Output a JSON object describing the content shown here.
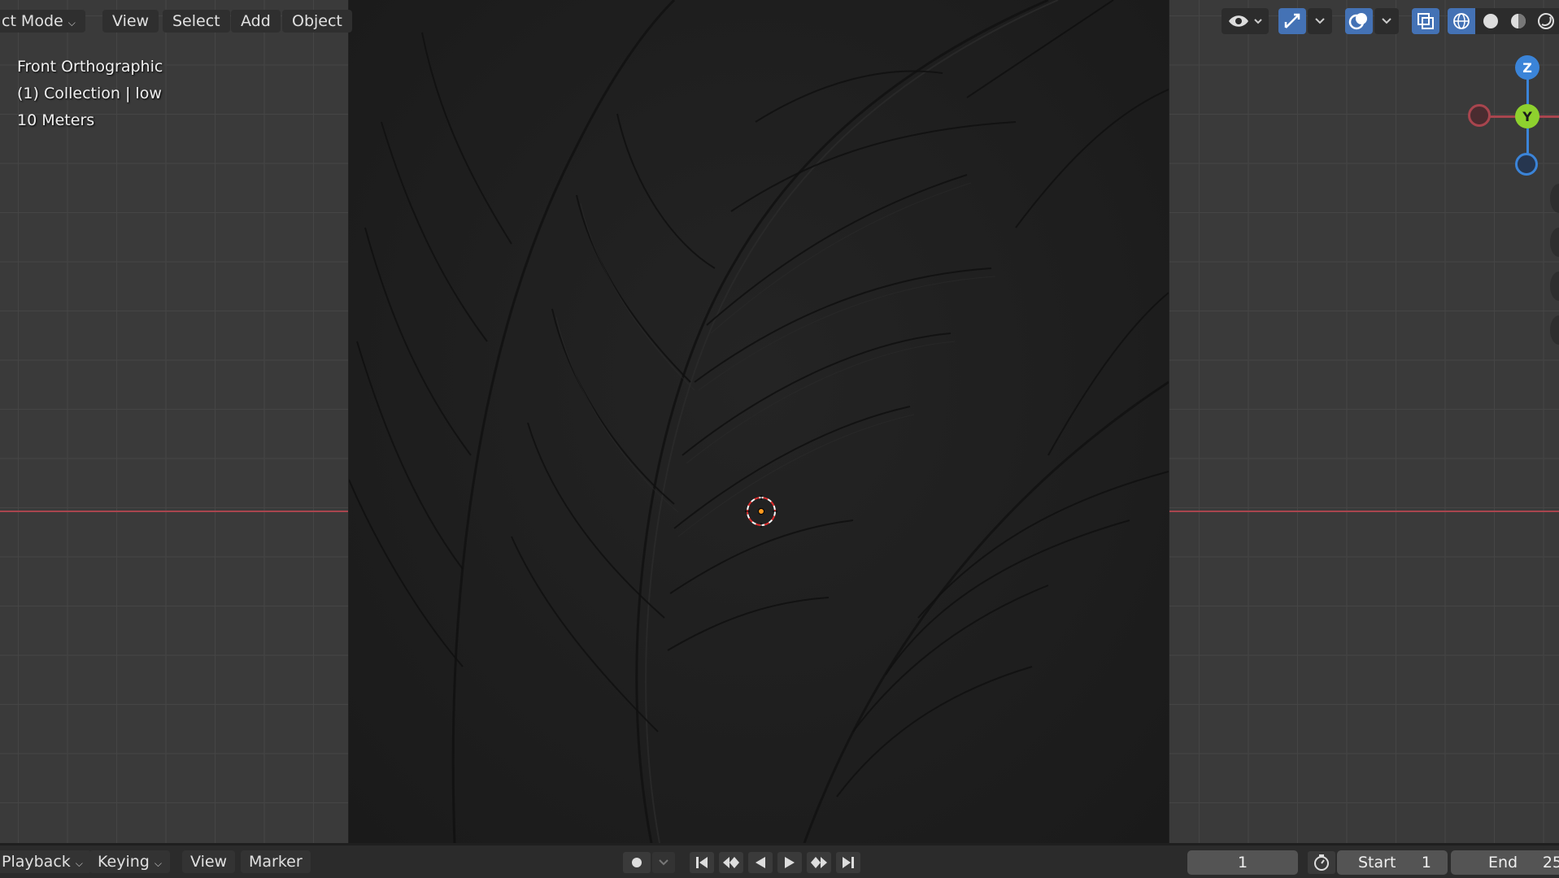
{
  "header": {
    "mode_label": "ct Mode",
    "menus": [
      "View",
      "Select",
      "Add",
      "Object"
    ]
  },
  "overlay": {
    "view_name": "Front Orthographic",
    "collection": "(1) Collection | low",
    "scale": "10 Meters"
  },
  "gizmo": {
    "z": "Z",
    "y": "Y"
  },
  "timeline": {
    "menus": [
      "Playback",
      "Keying",
      "View",
      "Marker"
    ],
    "current_frame": "1",
    "start_label": "Start",
    "start_value": "1",
    "end_label": "End",
    "end_value": "25"
  },
  "colors": {
    "x_axis": "#a8454e",
    "y_axis": "#7bc22b",
    "z_axis": "#3b84d8",
    "accent": "#4472b5"
  }
}
